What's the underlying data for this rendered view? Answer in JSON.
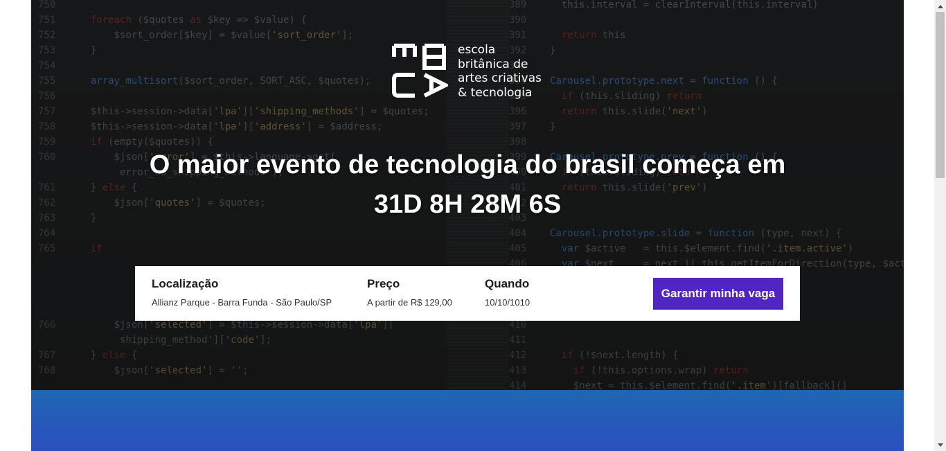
{
  "logo": {
    "lines": [
      "escola",
      "britânica de",
      "artes criativas",
      "& tecnologia"
    ],
    "mark_letters": "EBAC"
  },
  "hero": {
    "headline_line1": "O maior evento de tecnologia do brasil começa em",
    "countdown": "31D 8H 28M 6S"
  },
  "event_info": {
    "location_label": "Localização",
    "location_value": "Allianz Parque - Barra Funda - São Paulo/SP",
    "price_label": "Preço",
    "price_value": "A partir de R$ 129,00",
    "when_label": "Quando",
    "when_value": "10/10/1010",
    "cta_label": "Garantir minha vaga"
  },
  "colors": {
    "cta": "#5025c4",
    "band_top": "#1f66b4",
    "band_bottom": "#2b4fbd",
    "hero_bg": "#1e1f20"
  }
}
